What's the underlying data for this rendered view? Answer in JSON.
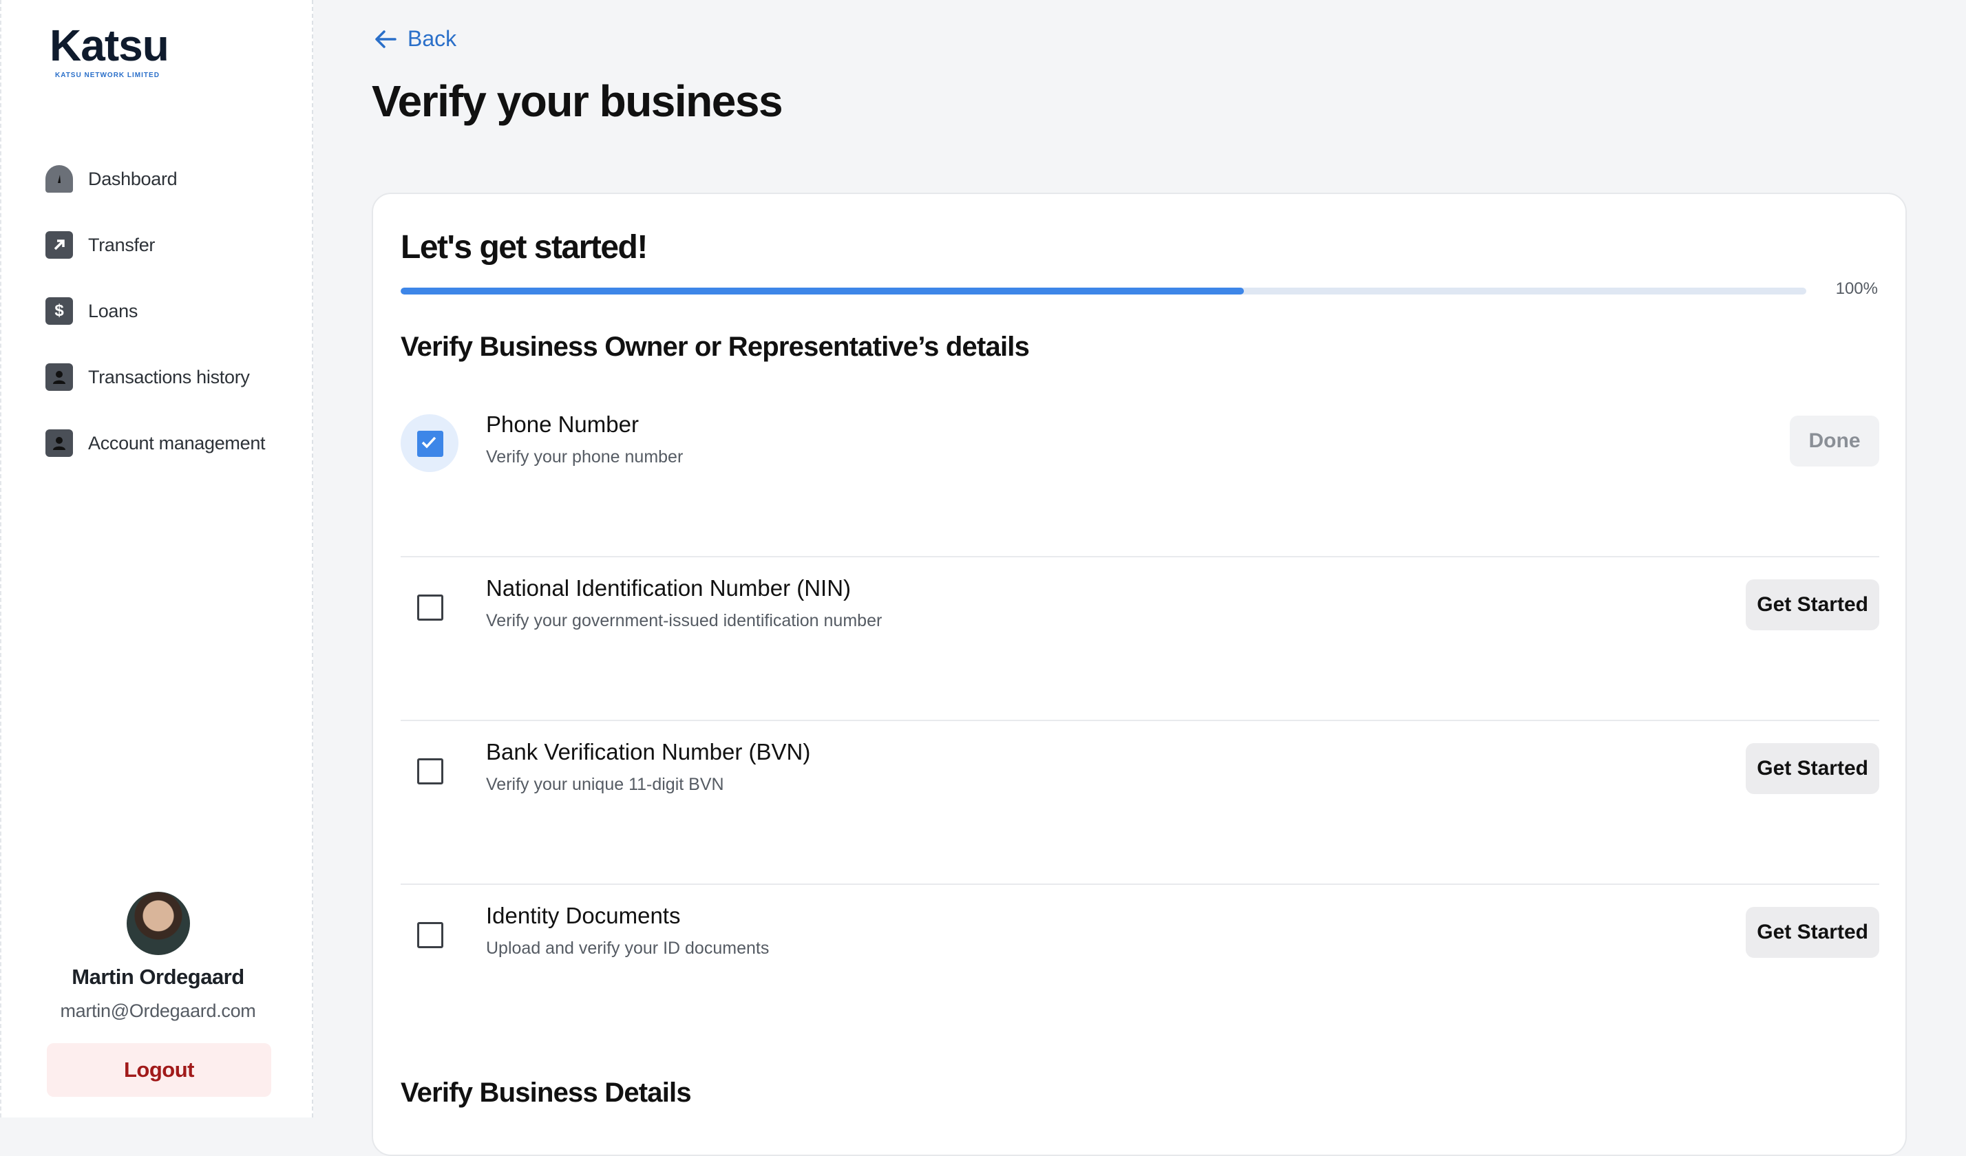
{
  "sidebar": {
    "logo": {
      "name": "Katsu",
      "subtitle": "KATSU NETWORK LIMITED"
    },
    "nav": [
      {
        "label": "Dashboard",
        "icon": "dashboard-icon"
      },
      {
        "label": "Transfer",
        "icon": "transfer-arrow-icon"
      },
      {
        "label": "Loans",
        "icon": "dollar-document-icon"
      },
      {
        "label": "Transactions history",
        "icon": "person-icon"
      },
      {
        "label": "Account management",
        "icon": "person-icon"
      }
    ],
    "profile": {
      "name": "Martin Ordegaard",
      "email": "martin@Ordegaard.com",
      "logout_label": "Logout"
    }
  },
  "main": {
    "back_label": "Back",
    "title": "Verify your business",
    "card": {
      "title": "Let's get started!",
      "progress": {
        "fill_fraction": 0.6,
        "label": "100%"
      },
      "section_owner": "Verify Business Owner or Representative’s details",
      "steps": [
        {
          "title": "Phone Number",
          "subtitle": "Verify your phone number",
          "button": "Done",
          "completed": true
        },
        {
          "title": "National Identification Number (NIN)",
          "subtitle": "Verify your government-issued identification number",
          "button": "Get Started",
          "completed": false
        },
        {
          "title": "Bank Verification Number (BVN)",
          "subtitle": "Verify your unique 11-digit BVN",
          "button": "Get Started",
          "completed": false
        },
        {
          "title": "Identity Documents",
          "subtitle": "Upload and verify your ID documents",
          "button": "Get Started",
          "completed": false
        }
      ],
      "section_business": "Verify Business Details"
    }
  },
  "colors": {
    "accent": "#3d86e8",
    "link": "#2a6fc9",
    "logout_text": "#a11a1a",
    "logout_bg": "#fdeeee",
    "page_bg": "#f4f5f7"
  }
}
